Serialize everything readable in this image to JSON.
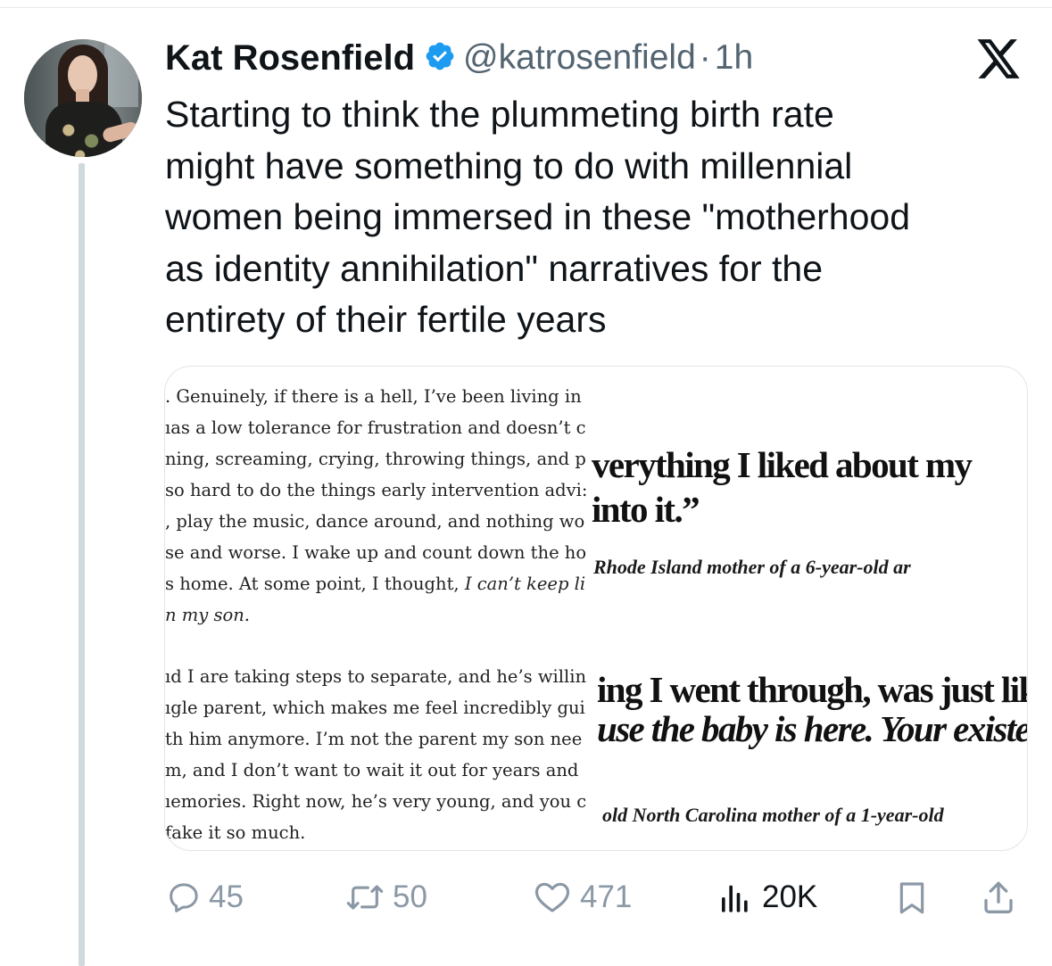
{
  "author": {
    "name": "Kat Rosenfield",
    "handle": "@katrosenfield",
    "separator": "·",
    "time": "1h"
  },
  "tweet": {
    "lines": [
      "Starting to think the plummeting birth rate",
      "might have something to do with millennial",
      "women being immersed in these \"motherhood",
      "as identity annihilation\" narratives for the",
      "entirety of their fertile years"
    ]
  },
  "media": {
    "left_paragraph_1": [
      ". Genuinely, if there is a hell, I’ve been living in",
      "ıas a low tolerance for frustration and doesn’t c",
      "ning, screaming, crying, throwing things, and p",
      "so hard to do the things early intervention advi:",
      ", play the music, dance around, and nothing wo",
      "se and worse. I wake up and count down the ho",
      "s home. At some point, I thought, ",
      "n my son."
    ],
    "left_paragraph_1_italic_tail": "I can’t keep li",
    "left_paragraph_2": [
      "ıd I are taking steps to separate, and he’s willin",
      "ıgle parent, which makes me feel incredibly gui",
      "th him anymore. I’m not the parent my son nee",
      "m, and I don’t want to wait it out for years and",
      "ıemories. Right now, he’s very young, and you c",
      "fake it so much."
    ],
    "right_quote_1": [
      "verything I liked about my",
      "into it.”"
    ],
    "right_caption_1": "Rhode Island mother of a 6-year-old ar",
    "right_quote_2": [
      "ing I went through, was just lik",
      "use the baby is here. Your existenc"
    ],
    "right_caption_2": "old North Carolina mother of a 1-year-old"
  },
  "actions": {
    "replies": "45",
    "reposts": "50",
    "likes": "471",
    "views": "20K"
  },
  "icons": {
    "verified": "verified-badge-icon",
    "platform": "x-logo-icon",
    "reply": "reply-icon",
    "repost": "repost-icon",
    "like": "heart-icon",
    "views": "views-chart-icon",
    "bookmark": "bookmark-icon",
    "share": "share-icon"
  },
  "colors": {
    "verified_blue": "#1d9bf0",
    "text": "#0f1419",
    "muted": "#536471",
    "action_muted": "#8b98a5",
    "thread_line": "#cfd9de"
  }
}
